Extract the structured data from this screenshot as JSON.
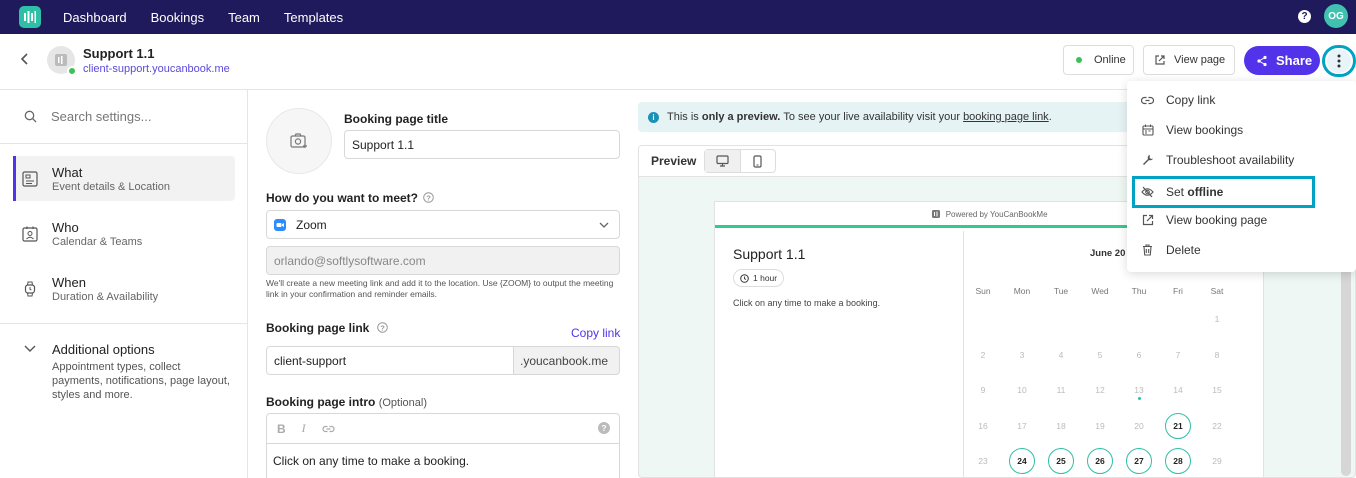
{
  "nav": {
    "items": [
      "Dashboard",
      "Bookings",
      "Team",
      "Templates"
    ],
    "help_label": "?",
    "user_initials": "OG"
  },
  "header": {
    "title": "Support 1.1",
    "url": "client-support.youcanbook.me",
    "online_label": "Online",
    "view_page_label": "View page",
    "share_label": "Share"
  },
  "sidebar": {
    "search_placeholder": "Search settings...",
    "items": [
      {
        "title": "What",
        "subtitle": "Event details & Location"
      },
      {
        "title": "Who",
        "subtitle": "Calendar & Teams"
      },
      {
        "title": "When",
        "subtitle": "Duration & Availability"
      }
    ],
    "additional": {
      "title": "Additional options",
      "description": "Appointment types, collect payments, notifications, page layout, styles and more."
    }
  },
  "form": {
    "title_label": "Booking page title",
    "title_value": "Support 1.1",
    "meet_label": "How do you want to meet?",
    "meet_value": "Zoom",
    "email_value": "orlando@softlysoftware.com",
    "hint": "We'll create a new meeting link and add it to the location. Use {ZOOM} to output the meeting link in your confirmation and reminder emails.",
    "link_label": "Booking page link",
    "copy_link": "Copy link",
    "link_value": "client-support",
    "link_suffix": ".youcanbook.me",
    "intro_label": "Booking page intro",
    "intro_optional": "(Optional)",
    "intro_value": "Click on any time to make a booking."
  },
  "preview": {
    "banner_prefix": "This is",
    "banner_bold": "only a preview.",
    "banner_mid": "To see your live availability visit your",
    "banner_link": "booking page link",
    "banner_end": ".",
    "label": "Preview",
    "powered": "Powered by YouCanBookMe",
    "title": "Support 1.1",
    "duration": "1 hour",
    "prompt": "Click on any time to make a booking.",
    "month": "June 20",
    "days_of_week": [
      "Sun",
      "Mon",
      "Tue",
      "Wed",
      "Thu",
      "Fri",
      "Sat"
    ],
    "weeks": [
      [
        "",
        "",
        "",
        "",
        "",
        "",
        "1"
      ],
      [
        "2",
        "3",
        "4",
        "5",
        "6",
        "7",
        "8"
      ],
      [
        "9",
        "10",
        "11",
        "12",
        "13",
        "14",
        "15"
      ],
      [
        "16",
        "17",
        "18",
        "19",
        "20",
        "21",
        "22"
      ],
      [
        "23",
        "24",
        "25",
        "26",
        "27",
        "28",
        "29"
      ]
    ],
    "available_days": [
      "21",
      "24",
      "25",
      "26",
      "27",
      "28"
    ],
    "today": "13"
  },
  "menu": {
    "items": [
      {
        "label": "Copy link",
        "icon": "link-icon"
      },
      {
        "label": "View bookings",
        "icon": "calendar-icon"
      },
      {
        "label": "Troubleshoot availability",
        "icon": "wrench-icon"
      },
      {
        "label_prefix": "Set",
        "label_bold": "offline",
        "icon": "eye-off-icon"
      },
      {
        "label": "View booking page",
        "icon": "external-link-icon"
      },
      {
        "label": "Delete",
        "icon": "trash-icon"
      }
    ]
  },
  "colors": {
    "nav_bg": "#1f1a5b",
    "brand": "#5233ea",
    "accent_teal": "#2fbfa6",
    "highlight": "#00a3c4"
  }
}
